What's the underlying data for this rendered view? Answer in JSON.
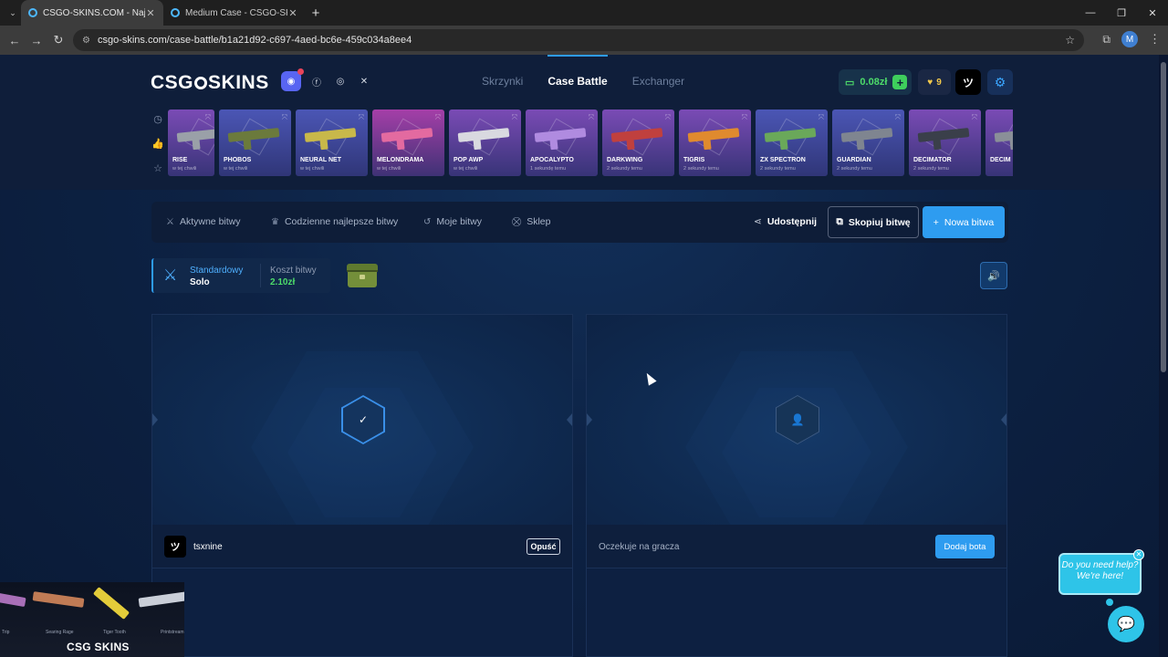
{
  "browser": {
    "tabs": [
      {
        "title": "CSGO-SKINS.COM - Najlepsze",
        "active": true
      },
      {
        "title": "Medium Case - CSGO-SKINS.C",
        "active": false
      }
    ],
    "url": "csgo-skins.com/case-battle/b1a21d92-c697-4aed-bc6e-459c034a8ee4",
    "profile_initial": "M"
  },
  "header": {
    "logo": {
      "left": "CSG",
      "right": "SKINS"
    },
    "nav": {
      "cases": "Skrzynki",
      "battle": "Case Battle",
      "exchanger": "Exchanger"
    },
    "balance": "0.08zł",
    "coins": "9"
  },
  "live_drops": [
    {
      "name": "RISE",
      "time": "w tej chwili",
      "color": "#7a4bb5"
    },
    {
      "name": "PHOBOS",
      "time": "w tej chwili",
      "color": "#4b56b5"
    },
    {
      "name": "NEURAL NET",
      "time": "w tej chwili",
      "color": "#4b56b5"
    },
    {
      "name": "MELONDRAMA",
      "time": "w tej chwili",
      "color": "#a53fa8"
    },
    {
      "name": "POP AWP",
      "time": "w tej chwili",
      "color": "#7a4bb5"
    },
    {
      "name": "APOCALYPTO",
      "time": "1 sekundę temu",
      "color": "#7a4bb5"
    },
    {
      "name": "DARKWING",
      "time": "2 sekundy temu",
      "color": "#7a4bb5"
    },
    {
      "name": "TIGRIS",
      "time": "2 sekundy temu",
      "color": "#7a4bb5"
    },
    {
      "name": "ZX SPECTRON",
      "time": "2 sekundy temu",
      "color": "#4b56b5"
    },
    {
      "name": "GUARDIAN",
      "time": "2 sekundy temu",
      "color": "#4b56b5"
    },
    {
      "name": "DECIMATOR",
      "time": "2 sekundy temu",
      "color": "#7a4bb5"
    },
    {
      "name": "DECIM",
      "time": "",
      "color": "#7a4bb5"
    }
  ],
  "battle_nav": {
    "active": "Aktywne bitwy",
    "daily": "Codzienne najlepsze bitwy",
    "mine": "Moje bitwy",
    "shop": "Sklep",
    "share": "Udostępnij",
    "copy": "Skopiuj bitwę",
    "new": "Nowa bitwa"
  },
  "battle_info": {
    "mode_type": "Standardowy",
    "mode": "Solo",
    "cost_label": "Koszt bitwy",
    "cost": "2.10zł"
  },
  "players": [
    {
      "name": "tsxnine",
      "status": "ready",
      "action": "Opuść"
    },
    {
      "waiting_text": "Oczekuje na gracza",
      "action": "Dodaj bota"
    }
  ],
  "help": {
    "line1": "Do you need help?",
    "line2": "We're here!"
  },
  "webcam": {
    "logo": "CSG SKINS",
    "captions": [
      "Trip",
      "Searing Rage",
      "Tiger Tooth",
      "Printstream"
    ]
  }
}
